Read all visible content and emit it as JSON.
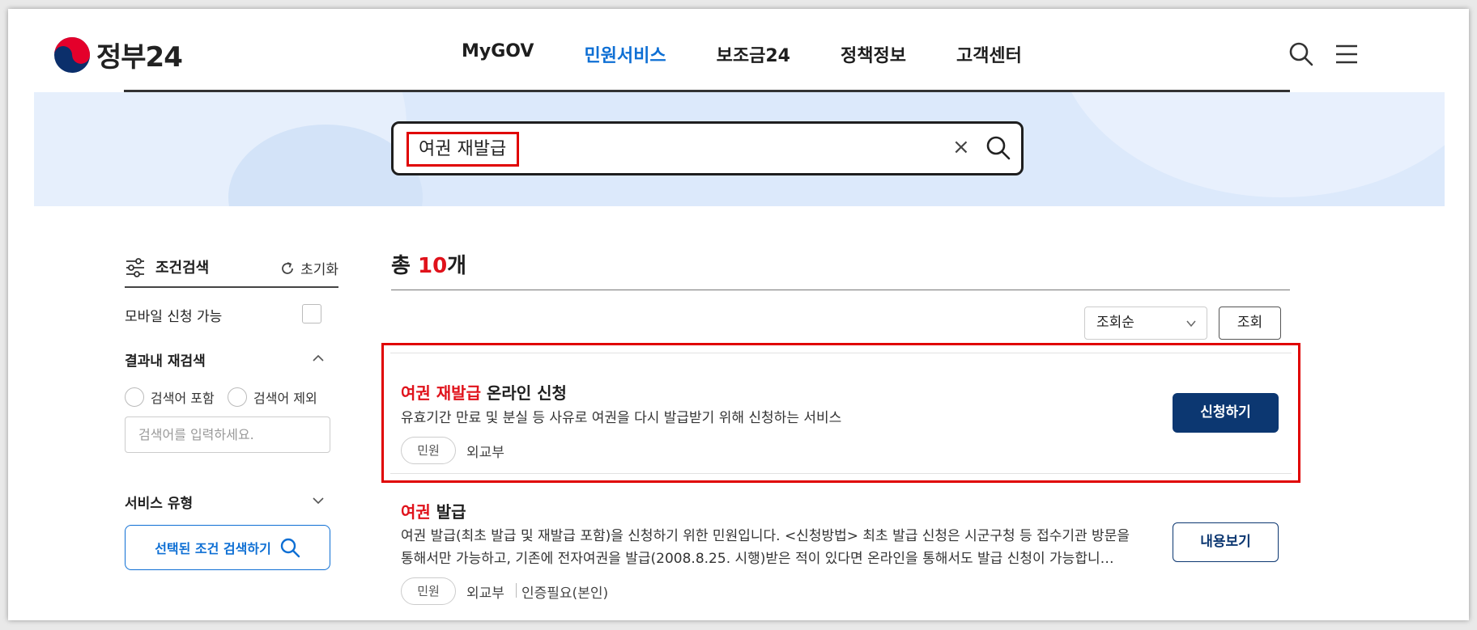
{
  "header": {
    "logo_text": "정부24",
    "nav": [
      {
        "label": "MyGOV",
        "active": false
      },
      {
        "label": "민원서비스",
        "active": true
      },
      {
        "label": "보조금24",
        "active": false
      },
      {
        "label": "정책정보",
        "active": false
      },
      {
        "label": "고객센터",
        "active": false
      }
    ],
    "icons": [
      "search-icon",
      "menu-icon"
    ]
  },
  "search": {
    "value": "여권 재발급",
    "clear_symbol": "×",
    "icon": "search-icon"
  },
  "sidebar": {
    "title": "조건검색",
    "reset_label": "초기화",
    "mobile_label": "모바일 신청 가능",
    "refine_label": "결과내 재검색",
    "include_label": "검색어 포함",
    "exclude_label": "검색어 제외",
    "keyword_placeholder": "검색어를 입력하세요.",
    "service_type_label": "서비스 유형",
    "search_button": "선택된 조건 검색하기"
  },
  "results": {
    "total_prefix": "총 ",
    "total_count": "10",
    "total_suffix": "개",
    "sort_value": "조회순",
    "sort_button": "조회",
    "items": [
      {
        "title_highlight": "여권 재발급",
        "title_rest": " 온라인 신청",
        "description": "유효기간 만료 및 분실 등 사유로 여권을 다시 발급받기 위해 신청하는 서비스",
        "tag": "민원",
        "org": "외교부",
        "action": "신청하기"
      },
      {
        "title_highlight": "여권",
        "title_rest": " 발급",
        "description_line1": "여권 발급(최초 발급 및 재발급 포함)을 신청하기 위한 민원입니다. <신청방법> 최초 발급 신청은 시군구청 등 접수기관 방문을",
        "description_line2": "통해서만 가능하고, 기존에 전자여권을 발급(2008.8.25. 시행)받은 적이 있다면 온라인을 통해서도 발급 신청이 가능합니…",
        "tag": "민원",
        "org": "외교부",
        "auth": "인증필요(본인)",
        "action": "내용보기"
      }
    ]
  },
  "colors": {
    "accent_blue": "#0e6fd4",
    "navy": "#0c3771",
    "highlight_red": "#e0121b",
    "annotation_red": "#e00000",
    "banner_bg": "#dce9fb"
  }
}
